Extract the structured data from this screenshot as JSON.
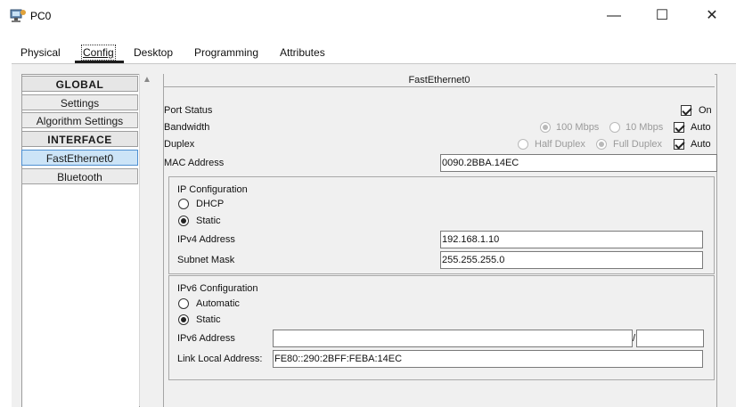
{
  "window": {
    "title": "PC0",
    "minimize_glyph": "—",
    "maximize_glyph": "☐",
    "close_glyph": "✕",
    "app_icon": "pc-icon"
  },
  "tabs": [
    {
      "label": "Physical",
      "active": false
    },
    {
      "label": "Config",
      "active": true
    },
    {
      "label": "Desktop",
      "active": false
    },
    {
      "label": "Programming",
      "active": false
    },
    {
      "label": "Attributes",
      "active": false
    }
  ],
  "sidebar": {
    "items": [
      {
        "label": "GLOBAL",
        "kind": "header"
      },
      {
        "label": "Settings",
        "kind": "button"
      },
      {
        "label": "Algorithm Settings",
        "kind": "button"
      },
      {
        "label": "INTERFACE",
        "kind": "header"
      },
      {
        "label": "FastEthernet0",
        "kind": "selected"
      },
      {
        "label": "Bluetooth",
        "kind": "button"
      }
    ]
  },
  "interface": {
    "title": "FastEthernet0",
    "port_status_label": "Port Status",
    "port_on_label": "On",
    "port_on_checked": true,
    "bandwidth_label": "Bandwidth",
    "bandwidth_100": "100 Mbps",
    "bandwidth_10": "10 Mbps",
    "bandwidth_auto_label": "Auto",
    "bandwidth_selected": "100 Mbps",
    "duplex_label": "Duplex",
    "duplex_half": "Half Duplex",
    "duplex_full": "Full Duplex",
    "duplex_auto_label": "Auto",
    "duplex_selected": "Full Duplex",
    "mac_label": "MAC Address",
    "mac_value": "0090.2BBA.14EC",
    "ipv4": {
      "group_label": "IP Configuration",
      "dhcp_label": "DHCP",
      "static_label": "Static",
      "mode": "Static",
      "address_label": "IPv4 Address",
      "address_value": "192.168.1.10",
      "mask_label": "Subnet Mask",
      "mask_value": "255.255.255.0"
    },
    "ipv6": {
      "group_label": "IPv6 Configuration",
      "auto_label": "Automatic",
      "static_label": "Static",
      "mode": "Static",
      "address_label": "IPv6 Address",
      "address_value": "",
      "prefix_separator": "/",
      "prefix_value": "",
      "link_local_label": "Link Local Address:",
      "link_local_value": "FE80::290:2BFF:FEBA:14EC"
    }
  }
}
